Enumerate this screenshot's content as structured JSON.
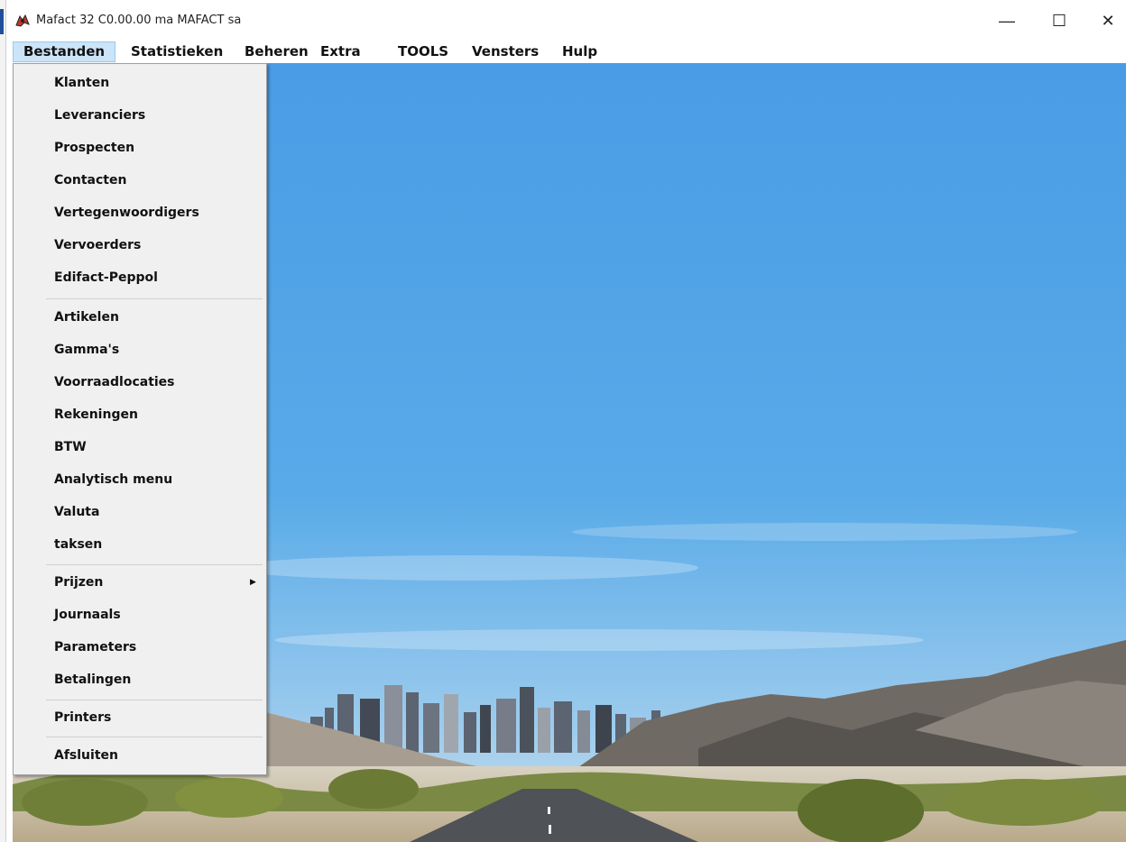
{
  "window": {
    "title": "Mafact 32 C0.00.00  ma MAFACT sa",
    "icon": "mafact-app-icon",
    "controls": {
      "minimize": "—",
      "maximize": "☐",
      "close": "✕"
    }
  },
  "menubar": {
    "items": [
      "Bestanden",
      "Statistieken",
      "Beheren",
      "Extra",
      "TOOLS",
      "Vensters",
      "Hulp"
    ],
    "active": "Bestanden"
  },
  "dropdown": {
    "items": [
      "Klanten",
      "Leveranciers",
      "Prospecten",
      "Contacten",
      "Vertegenwoordigers",
      "Vervoerders",
      "Edifact-Peppol",
      "Artikelen",
      "Gamma's",
      "Voorraadlocaties",
      "Rekeningen",
      "BTW",
      "Analytisch menu",
      "Valuta",
      "taksen",
      "Prijzen",
      "Journaals",
      "Parameters",
      "Betalingen",
      "Printers",
      "Afsluiten"
    ],
    "submenu_arrow": "▶"
  },
  "background": {
    "scene": "desert road with city skyline"
  },
  "colors": {
    "menu_highlight": "#cce4f7",
    "menu_highlight_border": "#99c9ef",
    "sky": "#4a9fe3"
  }
}
